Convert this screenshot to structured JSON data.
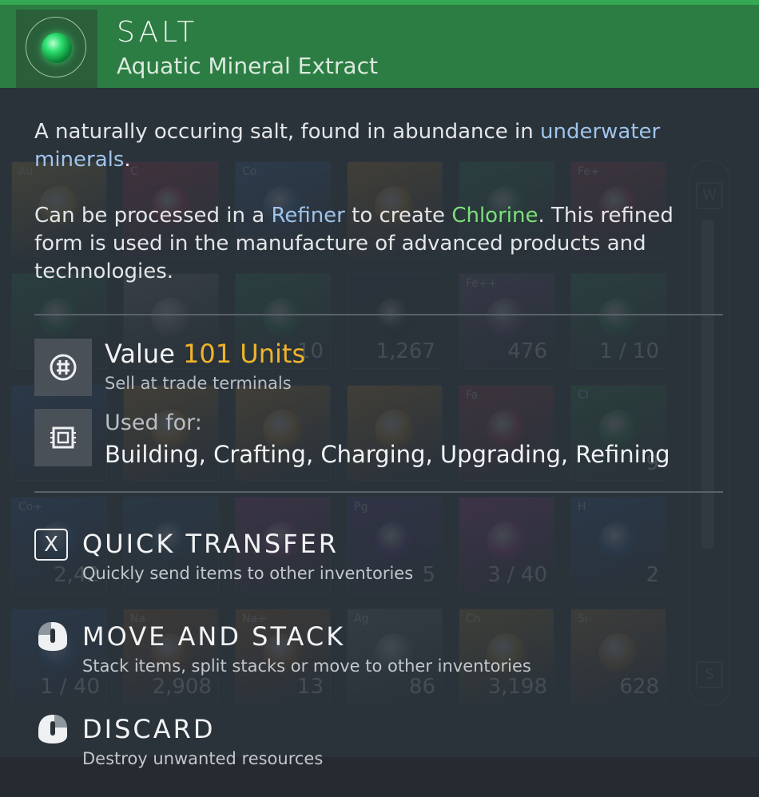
{
  "item": {
    "name": "SALT",
    "subtitle": "Aquatic Mineral Extract"
  },
  "description": {
    "p1_text": "A naturally occuring salt, found in abundance in ",
    "p1_link": "underwater minerals",
    "p1_end": ".",
    "p2_text1": "Can be processed in a ",
    "p2_link1": "Refiner",
    "p2_text2": " to create ",
    "p2_link2": "Chlorine",
    "p2_text3": ". This refined form is used in the manufacture of advanced products and technologies."
  },
  "value": {
    "label": "Value",
    "amount": "101 Units",
    "sub": "Sell at trade terminals"
  },
  "used_for": {
    "label": "Used for:",
    "list": "Building, Crafting, Charging, Upgrading, Refining"
  },
  "actions": [
    {
      "key": "X",
      "title": "QUICK TRANSFER",
      "desc": "Quickly send items to other inventories"
    },
    {
      "title": "MOVE AND STACK",
      "desc": "Stack items, split stacks or move to other inventories"
    },
    {
      "title": "DISCARD",
      "desc": "Destroy unwanted resources"
    }
  ],
  "background_inventory": {
    "row1": [
      {
        "sym": "Au",
        "count": "",
        "color": "#c9a23a"
      },
      {
        "sym": "C",
        "count": "",
        "color": "#c8304a"
      },
      {
        "sym": "Co",
        "count": "",
        "color": "#3a6fb0"
      },
      {
        "sym": "",
        "count": "",
        "color": "#d08a2a"
      },
      {
        "sym": "",
        "count": "",
        "color": "#2f8a5a"
      },
      {
        "sym": "Fe+",
        "count": "",
        "color": "#b03a4a"
      }
    ],
    "row2": [
      {
        "sym": "",
        "count": "",
        "color": "#2f8a5a"
      },
      {
        "sym": "",
        "count": "",
        "color": "#8a8a8a"
      },
      {
        "sym": "",
        "count": "10",
        "color": "#2f8a5a"
      },
      {
        "sym": "",
        "count": "1,267",
        "color": "#303840"
      },
      {
        "sym": "Fe++",
        "count": "476",
        "color": "#7a5a8a"
      },
      {
        "sym": "",
        "count": "1 / 10",
        "color": "#2f8a5a"
      }
    ],
    "row3": [
      {
        "sym": "",
        "count": "",
        "color": "#2a5fa0"
      },
      {
        "sym": "",
        "count": "",
        "color": "#d08a2a"
      },
      {
        "sym": "",
        "count": "",
        "color": "#d08a2a"
      },
      {
        "sym": "",
        "count": "",
        "color": "#d08a2a"
      },
      {
        "sym": "Fa",
        "count": "",
        "color": "#b03a4a"
      },
      {
        "sym": "Cl",
        "count": "9",
        "color": "#2f8a4a"
      }
    ],
    "row4": [
      {
        "sym": "Co+",
        "count": "2,42",
        "color": "#2a5fa0"
      },
      {
        "sym": "",
        "count": "",
        "color": "#2a5f80"
      },
      {
        "sym": "",
        "count": "",
        "color": "#a03a8a"
      },
      {
        "sym": "Pg",
        "count": "5",
        "color": "#5a3a8a"
      },
      {
        "sym": "",
        "count": "3 / 40",
        "color": "#b03a9a"
      },
      {
        "sym": "H",
        "count": "2",
        "color": "#2a5fa0"
      }
    ],
    "row5": [
      {
        "sym": "",
        "count": "1 / 40",
        "color": "#2a5fa0"
      },
      {
        "sym": "Na",
        "count": "2,908",
        "color": "#b06a2a"
      },
      {
        "sym": "Na+",
        "count": "13",
        "color": "#b06a2a"
      },
      {
        "sym": "Ag",
        "count": "86",
        "color": "#707880"
      },
      {
        "sym": "Ch",
        "count": "3,198",
        "color": "#b08a2a"
      },
      {
        "sym": "Si",
        "count": "628",
        "color": "#b07a3a"
      }
    ],
    "scroll_keys": [
      "W",
      "S"
    ]
  },
  "colors": {
    "header_green": "#2c7d43",
    "value_gold": "#f0b42a",
    "link_blue": "#9fc4ea",
    "chlorine_green": "#7ee07a"
  }
}
